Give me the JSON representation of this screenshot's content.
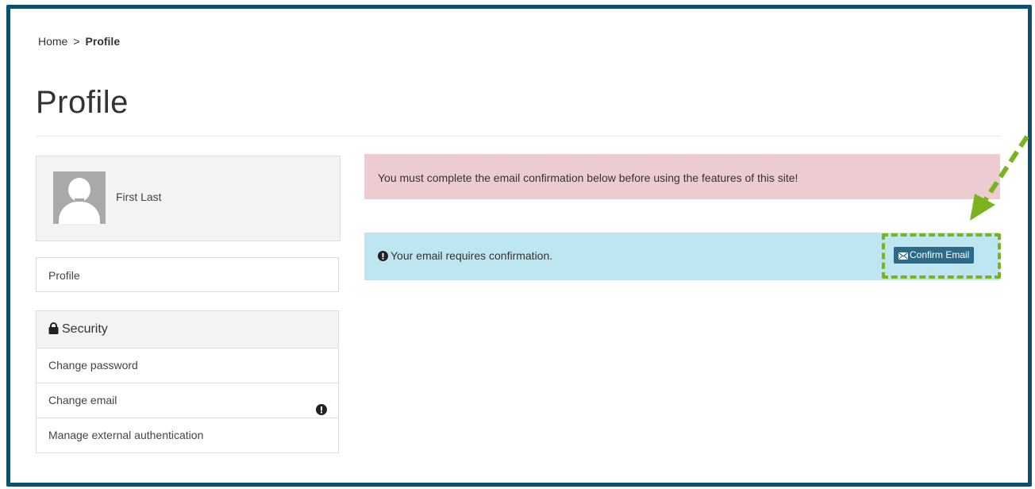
{
  "breadcrumb": {
    "home": "Home",
    "separator": ">",
    "current": "Profile"
  },
  "page": {
    "title": "Profile"
  },
  "user": {
    "name": "First Last",
    "avatar_icon": "user-avatar-placeholder"
  },
  "nav": {
    "profile_label": "Profile",
    "security": {
      "heading": "Security",
      "icon": "lock-icon",
      "items": [
        {
          "label": "Change password"
        },
        {
          "label": "Change email",
          "icon": "exclamation-circle-icon"
        },
        {
          "label": "Manage external authentication"
        }
      ]
    }
  },
  "alerts": {
    "danger": {
      "text": "You must complete the email confirmation below before using the features of this site!",
      "color": "#ecccd0"
    },
    "info": {
      "text": "Your email requires confirmation.",
      "icon": "exclamation-circle-icon",
      "color": "#bee6f0",
      "button_label": "Confirm Email",
      "button_icon": "envelope-icon"
    }
  },
  "annotation": {
    "highlight_color": "#7ab31e",
    "frame_color": "#0d4f72"
  }
}
